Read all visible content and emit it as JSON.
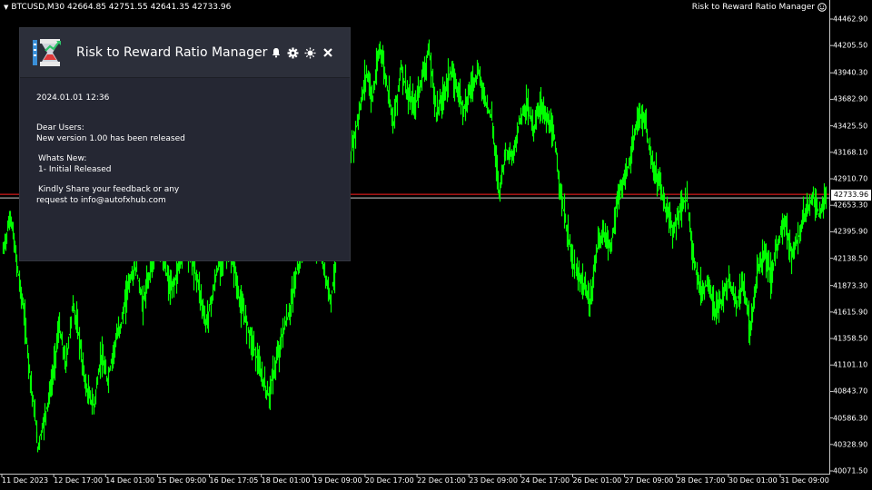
{
  "chart": {
    "symbol_info": "BTCUSD,M30  42664.85 42751.55 42641.35 42733.96",
    "ea_label": "Risk to Reward Ratio Manager",
    "current_price": "42733.96",
    "colors": {
      "background": "#000000",
      "candles": "#00ff00",
      "price_line_red": "#ff2020",
      "price_line_white": "#d0d0d0"
    }
  },
  "chart_data": {
    "type": "line",
    "y_ticks": [
      "44462.90",
      "44205.50",
      "43940.30",
      "43682.90",
      "43425.50",
      "43168.10",
      "42910.70",
      "42653.30",
      "42395.90",
      "42138.50",
      "41873.30",
      "41615.90",
      "41358.50",
      "41101.10",
      "40843.70",
      "40586.30",
      "40328.90",
      "40071.50"
    ],
    "x_ticks": [
      "11 Dec 2023",
      "12 Dec 17:00",
      "14 Dec 01:00",
      "15 Dec 09:00",
      "16 Dec 17:05",
      "18 Dec 01:00",
      "19 Dec 09:00",
      "20 Dec 17:00",
      "22 Dec 01:00",
      "23 Dec 09:00",
      "24 Dec 17:00",
      "26 Dec 01:00",
      "27 Dec 09:00",
      "28 Dec 17:00",
      "30 Dec 01:00",
      "31 Dec 09:00"
    ],
    "ylim": [
      40071.5,
      44462.9
    ],
    "series": [
      {
        "values": [
          42200,
          42550,
          42100,
          41600,
          40900,
          40300,
          40600,
          40950,
          41500,
          41100,
          41700,
          41300,
          40850,
          40700,
          41200,
          40950,
          41300,
          41550,
          41900,
          42050,
          41700,
          42000,
          42300,
          42100,
          41800,
          42000,
          42250,
          42150,
          41900,
          41500,
          41800,
          42100,
          42200,
          42050,
          41700,
          41500,
          41250,
          41000,
          40800,
          41100,
          41400,
          41600,
          42000,
          42250,
          42450,
          42300,
          42000,
          41750,
          42300,
          42700,
          43200,
          43550,
          43950,
          43700,
          44200,
          43800,
          43450,
          44000,
          43700,
          43600,
          43900,
          44150,
          43550,
          43700,
          43950,
          43800,
          43600,
          43800,
          43950,
          43700,
          43500,
          42800,
          43200,
          43100,
          43500,
          43650,
          43400,
          43650,
          43450,
          43300,
          42700,
          42300,
          42000,
          41900,
          41700,
          42200,
          42400,
          42250,
          42700,
          42900,
          43150,
          43550,
          43450,
          43000,
          42900,
          42600,
          42400,
          42650,
          42700,
          42100,
          41800,
          41900,
          41600,
          41750,
          41950,
          41700,
          41900,
          41400,
          42000,
          42200,
          41950,
          42300,
          42500,
          42150,
          42350,
          42600,
          42750,
          42550,
          42750
        ]
      }
    ]
  },
  "panel": {
    "title": "Risk to Reward Ratio Manager",
    "icons": [
      "bell-icon",
      "gear-icon",
      "sun-icon",
      "close-icon"
    ],
    "date": "2024.01.01 12:36",
    "message": {
      "greeting": "Dear Users:",
      "release": "New version 1.00 has been released",
      "whats_new": "Whats New:",
      "item1": "1- Initial Released",
      "feedback1": "Kindly Share your feedback or any",
      "feedback2": "request to info@autofxhub.com"
    }
  }
}
